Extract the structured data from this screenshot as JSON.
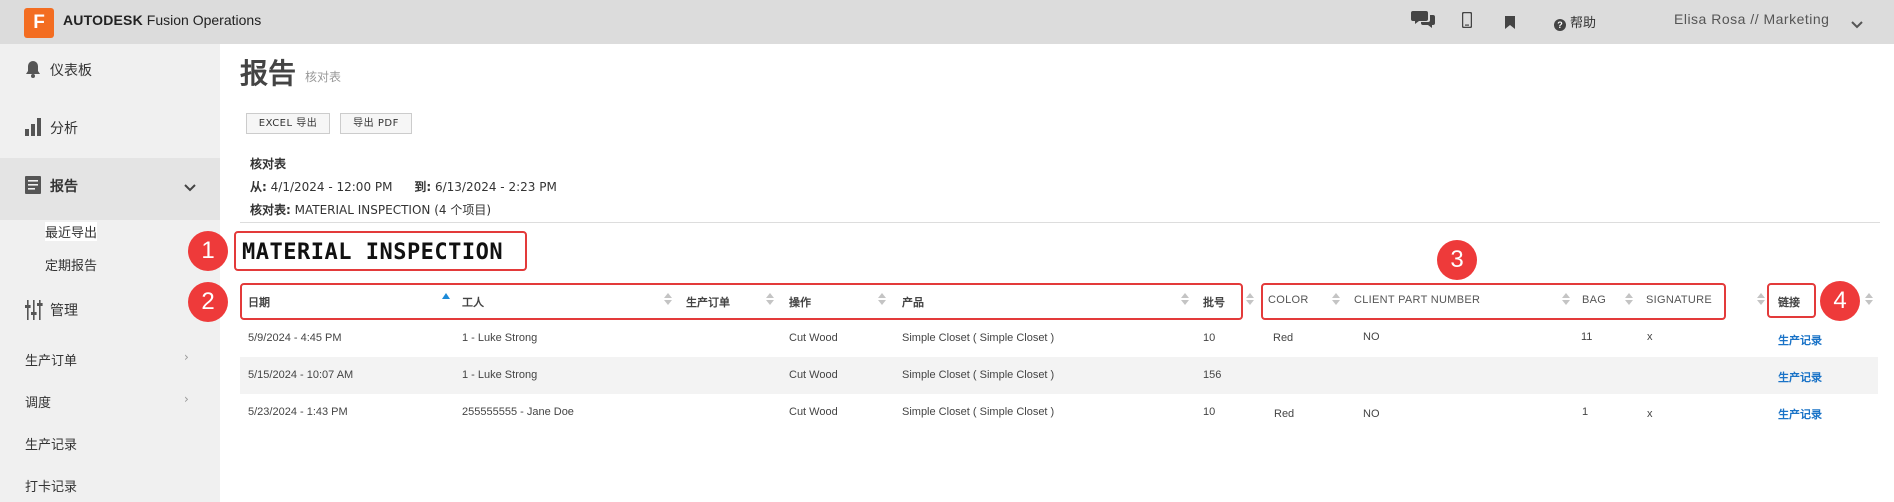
{
  "app": {
    "logo_letter": "F",
    "brand_bold": "AUTODESK",
    "brand_rest": " Fusion Operations",
    "help_label": "帮助",
    "user_label": "Elisa Rosa // Marketing"
  },
  "sidebar": {
    "dashboard": "仪表板",
    "analysis": "分析",
    "reports": "报告",
    "recent_exports": "最近导出",
    "scheduled_reports": "定期报告",
    "manage": "管理",
    "production_orders": "生产订单",
    "scheduling": "调度",
    "production_records": "生产记录",
    "clock_records": "打卡记录"
  },
  "page": {
    "title": "报告",
    "subtitle": "核对表",
    "export_excel": "EXCEL 导出",
    "export_pdf": "导出 PDF",
    "meta_heading": "核对表",
    "from_label": "从:",
    "from_value": "4/1/2024 - 12:00 PM",
    "to_label": "到:",
    "to_value": "6/13/2024 - 2:23 PM",
    "checklist_label": "核对表:",
    "checklist_value": "MATERIAL INSPECTION (4 个项目)"
  },
  "report": {
    "title": "MATERIAL INSPECTION",
    "columns": [
      "日期",
      "工人",
      "生产订单",
      "操作",
      "产品",
      "批号",
      "COLOR",
      "CLIENT PART NUMBER",
      "BAG",
      "SIGNATURE",
      "链接"
    ],
    "rows": [
      {
        "date": "5/9/2024 - 4:45 PM",
        "worker": "1 - Luke Strong",
        "order": "",
        "operation": "Cut Wood",
        "product": "Simple Closet ( Simple Closet )",
        "lot": "10",
        "color": "Red",
        "client_part": "NO",
        "bag": "11",
        "signature": "x",
        "link": "生产记录"
      },
      {
        "date": "5/15/2024 - 10:07 AM",
        "worker": "1 - Luke Strong",
        "order": "",
        "operation": "Cut Wood",
        "product": "Simple Closet ( Simple Closet )",
        "lot": "156",
        "color": "",
        "client_part": "",
        "bag": "",
        "signature": "",
        "link": "生产记录"
      },
      {
        "date": "5/23/2024 - 1:43 PM",
        "worker": "255555555 - Jane Doe",
        "order": "",
        "operation": "Cut Wood",
        "product": "Simple Closet ( Simple Closet )",
        "lot": "10",
        "color": "Red",
        "client_part": "NO",
        "bag": "1",
        "signature": "x",
        "link": "生产记录"
      }
    ]
  },
  "annotations": [
    "1",
    "2",
    "3",
    "4"
  ],
  "colors": {
    "accent": "#f36d21",
    "highlight": "#e33a3a",
    "link": "#1a73c7"
  }
}
